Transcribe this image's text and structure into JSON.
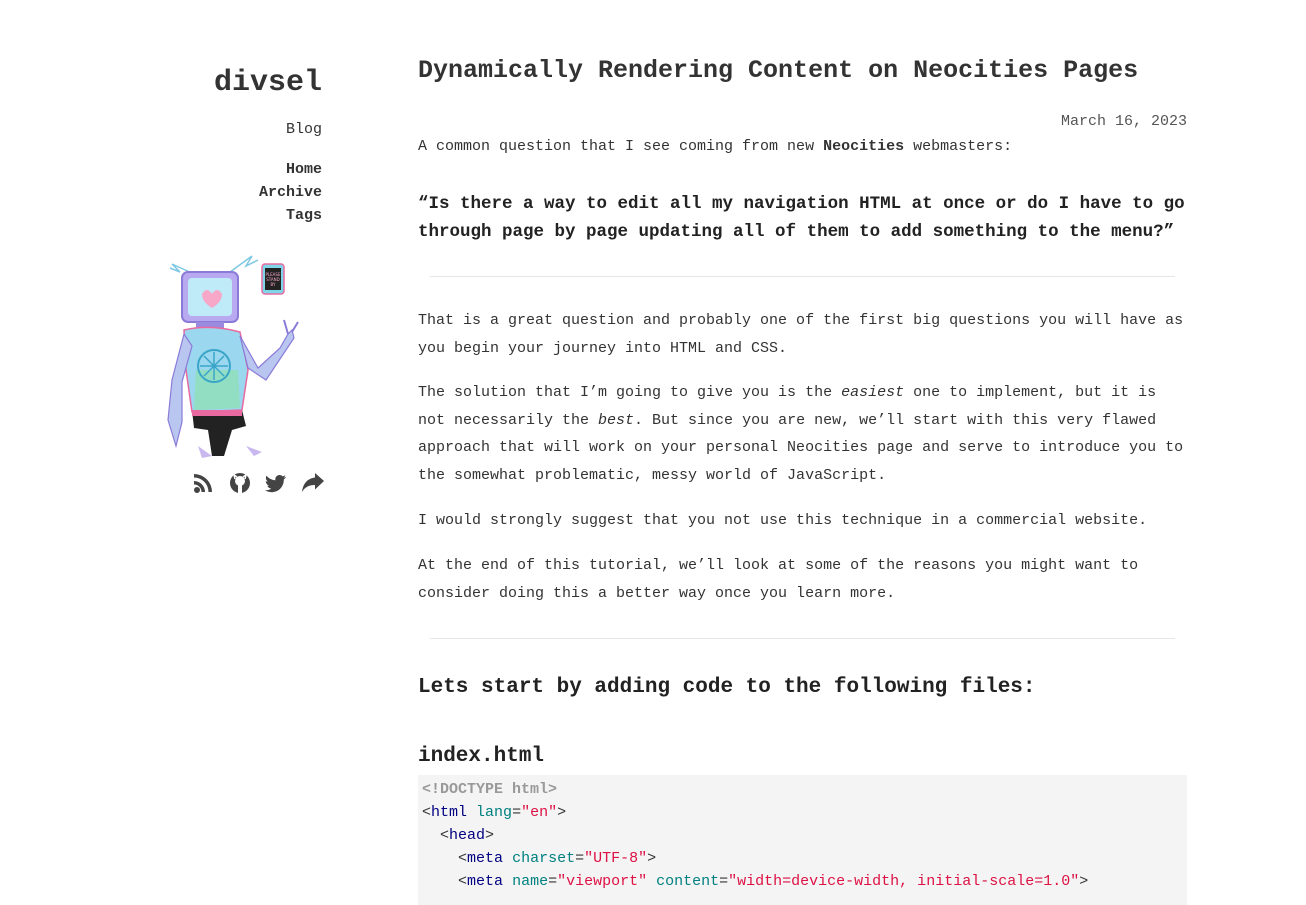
{
  "site": {
    "title": "divsel",
    "blog_label": "Blog"
  },
  "nav": {
    "items": [
      "Home",
      "Archive",
      "Tags"
    ]
  },
  "social": [
    "rss-icon",
    "github-icon",
    "twitter-icon",
    "share-icon"
  ],
  "post": {
    "title": "Dynamically Rendering Content on Neocities Pages",
    "date": "March 16, 2023",
    "intro_before": "A common question that I see coming from new ",
    "intro_bold": "Neocities",
    "intro_after": " webmasters:",
    "quote": "“Is there a way to edit all my navigation HTML at once or do I have to go through page by page updating all of them to add something to the menu?”",
    "p1": "That is a great question and probably one of the first big questions you will have as you begin your journey into HTML and CSS.",
    "p2_a": "The solution that I’m going to give you is the ",
    "p2_em1": "easiest",
    "p2_b": " one to implement, but it is not necessarily the ",
    "p2_em2": "best",
    "p2_c": ". But since you are new, we’ll start with this very flawed approach that will work on your personal Neocities page and serve to introduce you to the somewhat problematic, messy world of JavaScript.",
    "p3": "I would strongly suggest that you not use this technique in a commercial website.",
    "p4": "At the end of this tutorial, we’ll look at some of the reasons you might want to consider doing this a better way once you learn more.",
    "heading": "Lets start by adding code to the following files:",
    "file_heading": "index.html"
  },
  "code": {
    "doctype": "<!DOCTYPE html>",
    "l2_lt": "<",
    "l2_tag": "html",
    "l2_attr": "lang",
    "l2_eq": "=",
    "l2_val": "\"en\"",
    "l2_gt": ">",
    "l3_lt": "<",
    "l3_tag": "head",
    "l3_gt": ">",
    "l4_lt": "<",
    "l4_tag": "meta",
    "l4_attr": "charset",
    "l4_eq": "=",
    "l4_val": "\"UTF-8\"",
    "l4_gt": ">",
    "l5_lt": "<",
    "l5_tag": "meta",
    "l5_attr1": "name",
    "l5_eq1": "=",
    "l5_val1": "\"viewport\"",
    "l5_attr2": "content",
    "l5_eq2": "=",
    "l5_val2": "\"width=device-width, initial-scale=1.0\"",
    "l5_gt": ">"
  }
}
